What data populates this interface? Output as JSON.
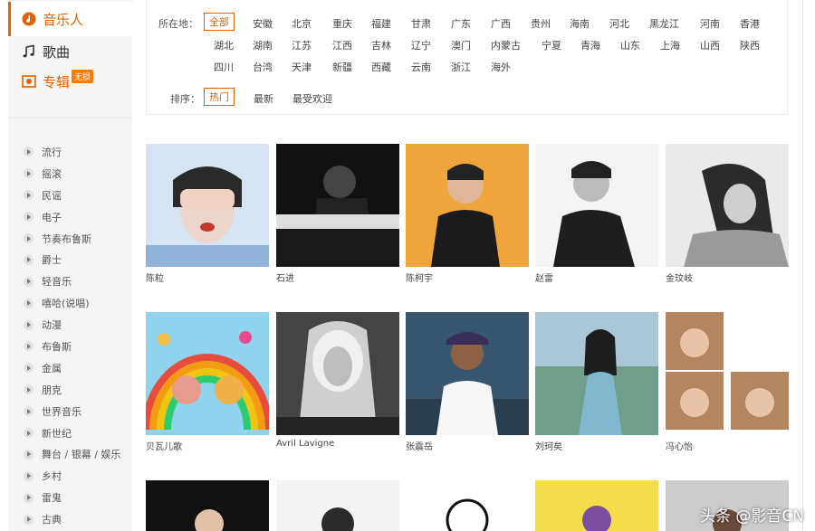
{
  "nav": {
    "items": [
      {
        "label": "音乐人",
        "icon": "music-person-icon"
      },
      {
        "label": "歌曲",
        "icon": "music-note-icon"
      },
      {
        "label": "专辑",
        "icon": "album-icon",
        "badge": "无损"
      }
    ]
  },
  "genres": [
    "流行",
    "摇滚",
    "民谣",
    "电子",
    "节奏布鲁斯",
    "爵士",
    "轻音乐",
    "嘻哈(说唱)",
    "动漫",
    "布鲁斯",
    "金属",
    "朋克",
    "世界音乐",
    "新世纪",
    "舞台 / 银幕 / 娱乐",
    "乡村",
    "雷鬼",
    "古典"
  ],
  "filter": {
    "location_label": "所在地：",
    "locations": [
      "全部",
      "安徽",
      "北京",
      "重庆",
      "福建",
      "甘肃",
      "广东",
      "广西",
      "贵州",
      "海南",
      "河北",
      "黑龙江",
      "河南",
      "香港",
      "湖北",
      "湖南",
      "江苏",
      "江西",
      "吉林",
      "辽宁",
      "澳门",
      "内蒙古",
      "宁夏",
      "青海",
      "山东",
      "上海",
      "山西",
      "陕西",
      "四川",
      "台湾",
      "天津",
      "新疆",
      "西藏",
      "云南",
      "浙江",
      "海外"
    ],
    "selected_location": "全部",
    "sort_label": "排序：",
    "sorts": [
      "热门",
      "最新",
      "最受欢迎"
    ],
    "selected_sort": "热门"
  },
  "artists": [
    "陈粒",
    "石进",
    "陈柯宇",
    "赵雷",
    "金玟岐",
    "贝瓦儿歌",
    "Avril Lavigne",
    "张震岳",
    "刘珂矣",
    "冯心怡"
  ],
  "watermark": "头条 @影音CN",
  "colors": {
    "accent": "#e36100",
    "sidebar_bg": "#f5f5f5"
  }
}
